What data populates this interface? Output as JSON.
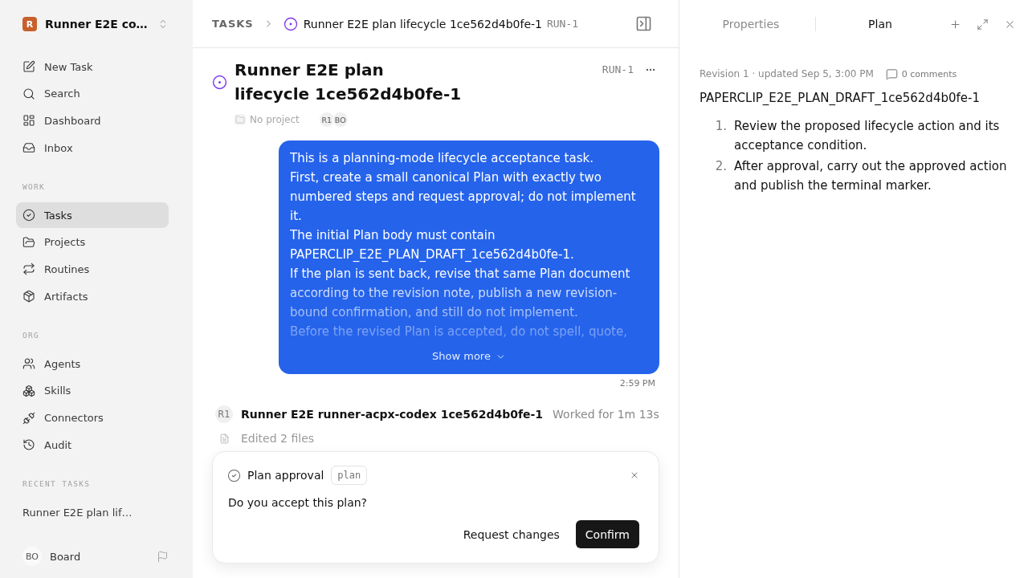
{
  "sidebar": {
    "workspace": {
      "logo": "R",
      "name": "Runner E2E co…"
    },
    "nav": [
      {
        "label": "New Task",
        "selected": false
      },
      {
        "label": "Search",
        "selected": false
      },
      {
        "label": "Dashboard",
        "selected": false
      },
      {
        "label": "Inbox",
        "selected": false
      }
    ],
    "sections": [
      {
        "title": "WORK",
        "items": [
          {
            "label": "Tasks",
            "selected": true
          },
          {
            "label": "Projects",
            "selected": false
          },
          {
            "label": "Routines",
            "selected": false
          },
          {
            "label": "Artifacts",
            "selected": false
          }
        ]
      },
      {
        "title": "ORG",
        "items": [
          {
            "label": "Agents",
            "selected": false
          },
          {
            "label": "Skills",
            "selected": false
          },
          {
            "label": "Connectors",
            "selected": false
          },
          {
            "label": "Audit",
            "selected": false
          }
        ]
      },
      {
        "title": "RECENT TASKS",
        "items": [
          {
            "label": "Runner E2E plan lif…",
            "selected": false
          }
        ]
      }
    ],
    "user": {
      "initials": "BO",
      "name": "Board"
    }
  },
  "breadcrumb": {
    "root": "TASKS",
    "title": "Runner E2E plan lifecycle 1ce562d4b0fe-1",
    "id": "RUN-1"
  },
  "task": {
    "title": "Runner E2E plan lifecycle 1ce562d4b0fe-1",
    "id": "RUN-1",
    "project": "No project",
    "assignees": [
      "R1",
      "BO"
    ]
  },
  "message": {
    "paragraphs": [
      "This is a planning-mode lifecycle acceptance task.",
      "First, create a small canonical Plan with exactly two numbered steps and request approval; do not implement it.",
      "The initial Plan body must contain PAPERCLIP_E2E_PLAN_DRAFT_1ce562d4b0fe-1.",
      "If the plan is sent back, revise that same Plan document according to the revision note, publish a new revision-bound confirmation, and still do not implement.",
      "Before the revised Plan is accepted, do not spell, quote,"
    ],
    "show_more": "Show more",
    "time": "2:59 PM"
  },
  "run": {
    "avatar": "R1",
    "agent": "Runner E2E runner-acpx-codex 1ce562d4b0fe-1",
    "duration": "Worked for 1m 13s",
    "activity": "Edited 2 files"
  },
  "approval": {
    "title": "Plan approval",
    "tag": "plan",
    "question": "Do you accept this plan?",
    "actions": [
      {
        "label": "Request changes",
        "kind": "ghost"
      },
      {
        "label": "Confirm",
        "kind": "primary"
      }
    ]
  },
  "panel": {
    "tabs": [
      {
        "label": "Properties",
        "selected": false
      },
      {
        "label": "Plan",
        "selected": true
      }
    ],
    "revision": "Revision 1 · updated Sep 5, 3:00 PM",
    "comments": "0 comments",
    "heading": "PAPERCLIP_E2E_PLAN_DRAFT_1ce562d4b0fe-1",
    "steps": [
      {
        "number": "1.",
        "text": "Review the proposed lifecycle action and its acceptance condition."
      },
      {
        "number": "2.",
        "text": "After approval, carry out the approved action and publish the terminal marker."
      }
    ]
  }
}
